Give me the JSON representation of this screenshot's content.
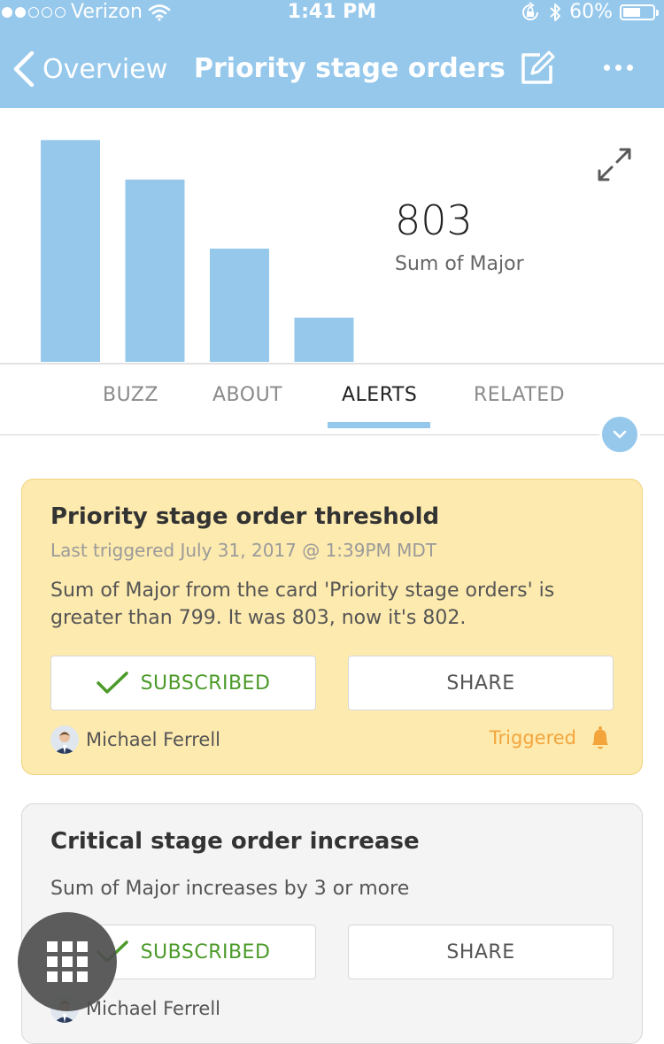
{
  "status_bar": {
    "carrier": "Verizon",
    "time": "1:41 PM",
    "battery_text": "60%",
    "battery_level": 0.6
  },
  "nav": {
    "back_label": "Overview",
    "title": "Priority stage orders",
    "icons": [
      "chevron-left-icon",
      "edit-icon",
      "more-icon"
    ]
  },
  "chart_data": {
    "type": "bar",
    "categories": [
      "",
      "",
      "",
      ""
    ],
    "values": [
      803,
      660,
      410,
      160
    ],
    "ylim": [
      0,
      820
    ],
    "color": "#96c8ec",
    "title": "",
    "xlabel": "",
    "ylabel": "",
    "grid": false
  },
  "kpi": {
    "value": "803",
    "label": "Sum of Major"
  },
  "tabs": [
    {
      "label": "BUZZ",
      "active": false
    },
    {
      "label": "ABOUT",
      "active": false
    },
    {
      "label": "ALERTS",
      "active": true
    },
    {
      "label": "RELATED",
      "active": false
    }
  ],
  "alerts": [
    {
      "title": "Priority stage order threshold",
      "last_triggered": "Last triggered July 31, 2017 @ 1:39PM MDT",
      "description": "Sum of Major from the card 'Priority stage orders' is greater than 799. It was 803, now it's 802.",
      "subscribe_label": "SUBSCRIBED",
      "share_label": "SHARE",
      "owner": "Michael Ferrell",
      "status": "Triggered",
      "background": "#fdeaae"
    },
    {
      "title": "Critical stage order increase",
      "description": "Sum of Major increases by 3 or more",
      "subscribe_label": "SUBSCRIBED",
      "share_label": "SHARE",
      "owner": "Michael Ferrell",
      "background": "#f4f4f4"
    }
  ],
  "colors": {
    "header": "#96c8ec",
    "subscribed": "#4c9a2a",
    "triggered": "#f3a53c"
  }
}
